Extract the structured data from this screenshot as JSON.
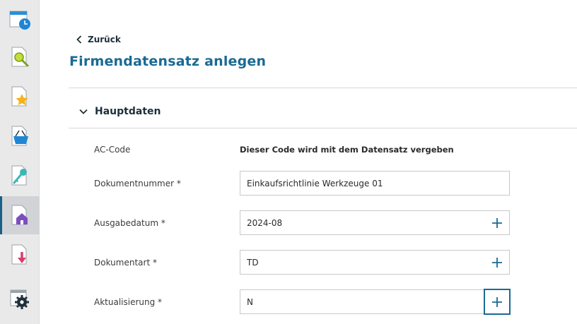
{
  "colors": {
    "accent": "#1a6a93",
    "dark_text": "#1d2f3a",
    "sidebar_bg": "#e9e9ea",
    "active_bar": "#1a5f86"
  },
  "sidebar": {
    "items": [
      {
        "icon": "calendar-clock-icon",
        "active": false
      },
      {
        "icon": "document-search-icon",
        "active": false
      },
      {
        "icon": "document-star-icon",
        "active": false
      },
      {
        "icon": "shopping-basket-icon",
        "active": false
      },
      {
        "icon": "key-icon",
        "active": false
      },
      {
        "icon": "document-home-icon",
        "active": true
      },
      {
        "icon": "document-download-icon",
        "active": false
      },
      {
        "icon": "settings-gear-icon",
        "active": false
      }
    ]
  },
  "header": {
    "back_label": "Zurück",
    "title": "Firmendatensatz anlegen"
  },
  "section": {
    "label": "Hauptdaten",
    "expanded": true
  },
  "form": {
    "ac_code": {
      "label": "AC-Code",
      "value": "Dieser Code wird mit dem Datensatz vergeben"
    },
    "dokumentnummer": {
      "label": "Dokumentnummer *",
      "value": "Einkaufsrichtlinie Werkzeuge 01"
    },
    "ausgabedatum": {
      "label": "Ausgabedatum *",
      "value": "2024-08"
    },
    "dokumentart": {
      "label": "Dokumentart *",
      "value": "TD"
    },
    "aktualisierung": {
      "label": "Aktualisierung *",
      "value": "N"
    }
  }
}
